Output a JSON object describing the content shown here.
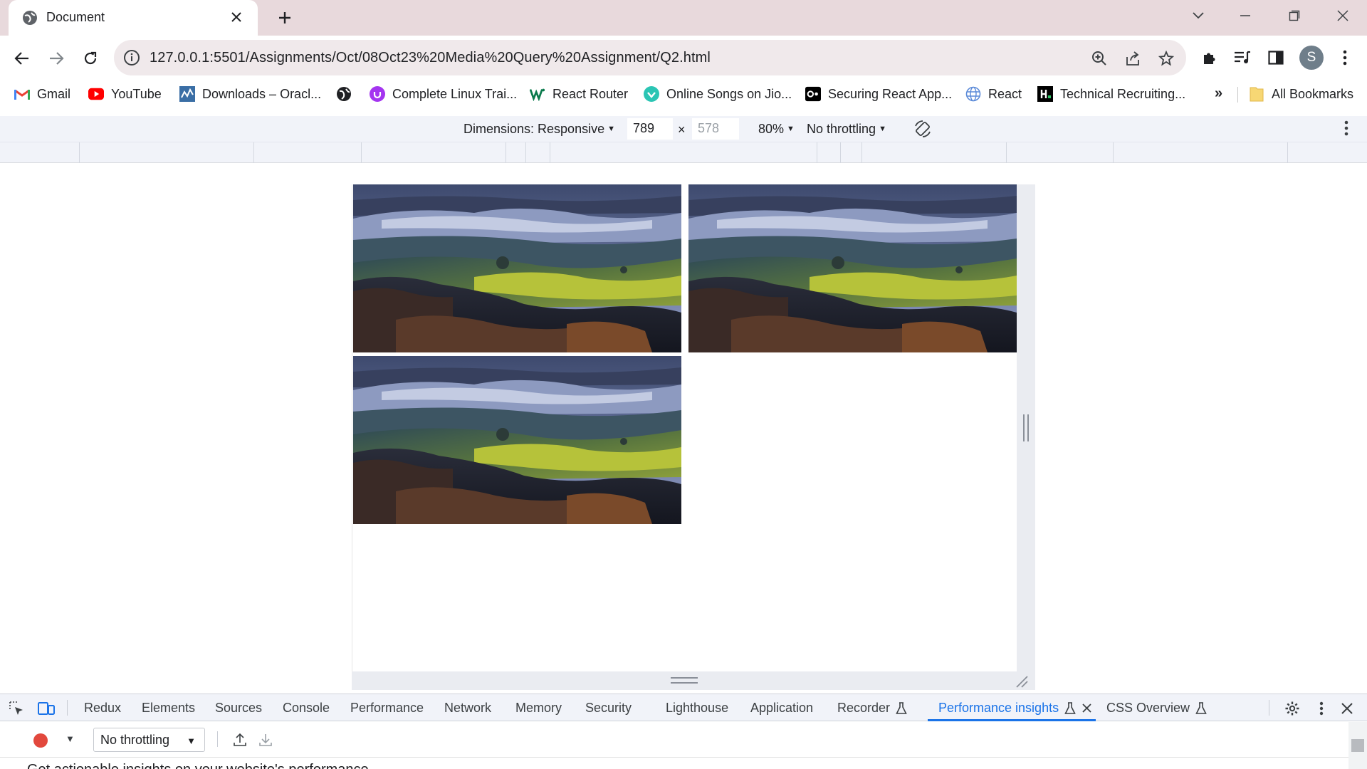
{
  "browser": {
    "tab": {
      "title": "Document"
    },
    "url": {
      "host": "127.0.0.1",
      "path": ":5501/Assignments/Oct/08Oct23%20Media%20Query%20Assignment/Q2.html"
    },
    "bookmarks": [
      {
        "label": "Gmail",
        "icon": "gmail-icon"
      },
      {
        "label": "YouTube",
        "icon": "youtube-icon"
      },
      {
        "label": "Downloads – Oracl...",
        "icon": "oracle-icon"
      },
      {
        "label": "",
        "icon": "globe-icon"
      },
      {
        "label": "Complete Linux Trai...",
        "icon": "udemy-icon"
      },
      {
        "label": "React Router",
        "icon": "w-logo-icon"
      },
      {
        "label": "Online Songs on Jio...",
        "icon": "jiosaavn-icon"
      },
      {
        "label": "Securing React App...",
        "icon": "okta-icon"
      },
      {
        "label": "React",
        "icon": "globe-icon"
      },
      {
        "label": "Technical Recruiting...",
        "icon": "hackerrank-icon"
      }
    ],
    "bookmarks_more": "»",
    "all_bookmarks": "All Bookmarks",
    "avatar_letter": "S"
  },
  "device_toolbar": {
    "dimensions_label": "Dimensions: Responsive",
    "width": "789",
    "height": "578",
    "times": "×",
    "zoom": "80%",
    "throttling": "No throttling"
  },
  "page": {
    "images": [
      {
        "alt": "Landscape photo of rolling hills under a cloudy sky"
      },
      {
        "alt": "Landscape photo of rolling hills under a cloudy sky"
      },
      {
        "alt": "Landscape photo of rolling hills under a cloudy sky"
      }
    ]
  },
  "devtools": {
    "tabs": [
      {
        "label": "Redux",
        "active": false
      },
      {
        "label": "Elements",
        "active": false
      },
      {
        "label": "Sources",
        "active": false
      },
      {
        "label": "Console",
        "active": false
      },
      {
        "label": "Performance",
        "active": false
      },
      {
        "label": "Network",
        "active": false
      },
      {
        "label": "Memory",
        "active": false
      },
      {
        "label": "Security",
        "active": false
      },
      {
        "label": "Lighthouse",
        "active": false
      },
      {
        "label": "Application",
        "active": false
      },
      {
        "label": "Recorder",
        "active": false,
        "experimental": true
      },
      {
        "label": "Performance insights",
        "active": true,
        "experimental": true,
        "closable": true
      },
      {
        "label": "CSS Overview",
        "active": false,
        "experimental": true
      }
    ],
    "performance_insights": {
      "throttling_value": "No throttling",
      "intro_text_partial": "Get actionable insights on your website's performance"
    }
  },
  "colors": {
    "tabstrip": "#e8d9dc",
    "omnibox": "#f0e9eb",
    "devtools_accent": "#1a73e8",
    "record": "#e2483d"
  }
}
